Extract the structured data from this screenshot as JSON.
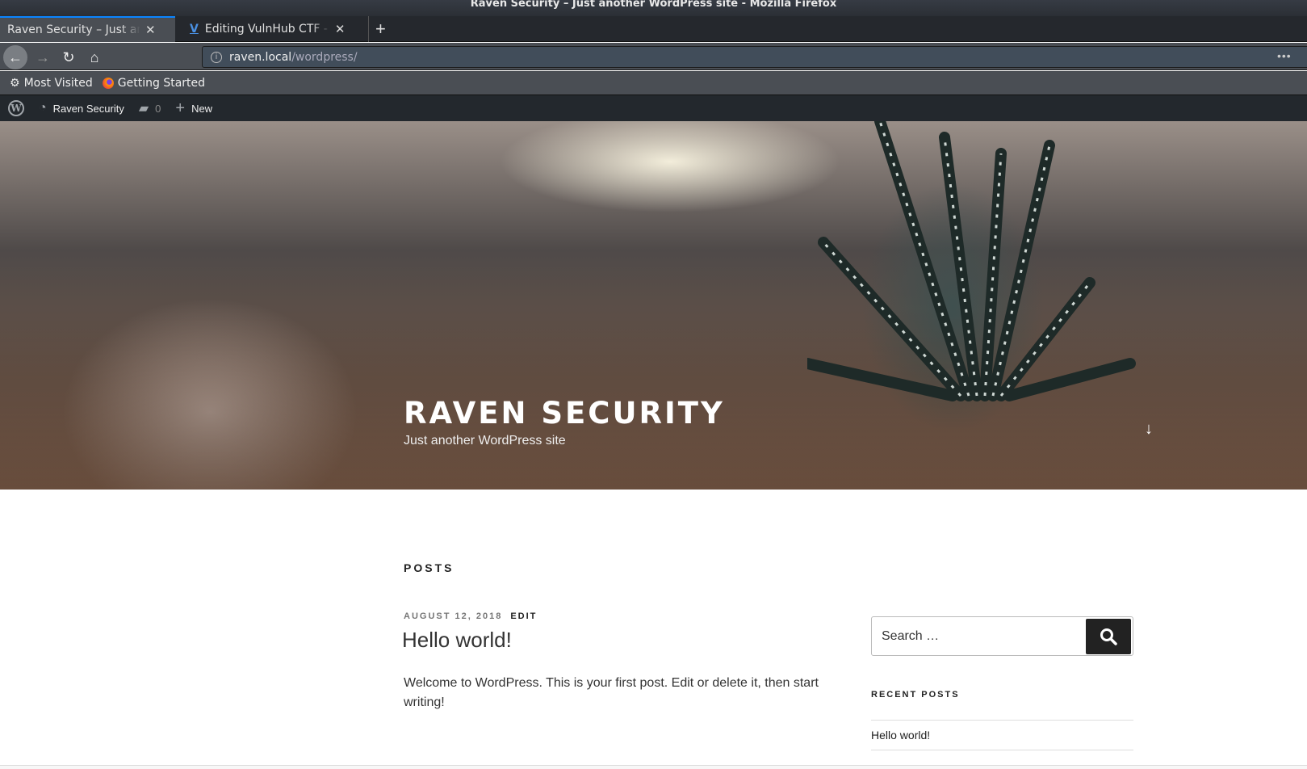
{
  "window": {
    "title": "Raven Security – Just another WordPress site - Mozilla Firefox"
  },
  "tabs": [
    {
      "label": "Raven Security – Just another WordPress site",
      "active": true
    },
    {
      "label": "Editing VulnHub CTF - Raven",
      "active": false
    }
  ],
  "new_tab": "+",
  "nav": {
    "url_host": "raven.local",
    "url_path": "/wordpress/",
    "menu": "•••"
  },
  "bookmarks": [
    {
      "label": "Most Visited"
    },
    {
      "label": "Getting Started"
    }
  ],
  "adminbar": {
    "site": "Raven Security",
    "comments": "0",
    "new": "New"
  },
  "hero": {
    "title": "RAVEN SECURITY",
    "tagline": "Just another WordPress site"
  },
  "main": {
    "heading": "POSTS",
    "post": {
      "date": "AUGUST 12, 2018",
      "edit": "EDIT",
      "title": "Hello world!",
      "excerpt": "Welcome to WordPress. This is your first post. Edit or delete it, then start writing!"
    }
  },
  "sidebar": {
    "search_placeholder": "Search …",
    "recent_heading": "RECENT POSTS",
    "recent": [
      "Hello world!"
    ]
  }
}
